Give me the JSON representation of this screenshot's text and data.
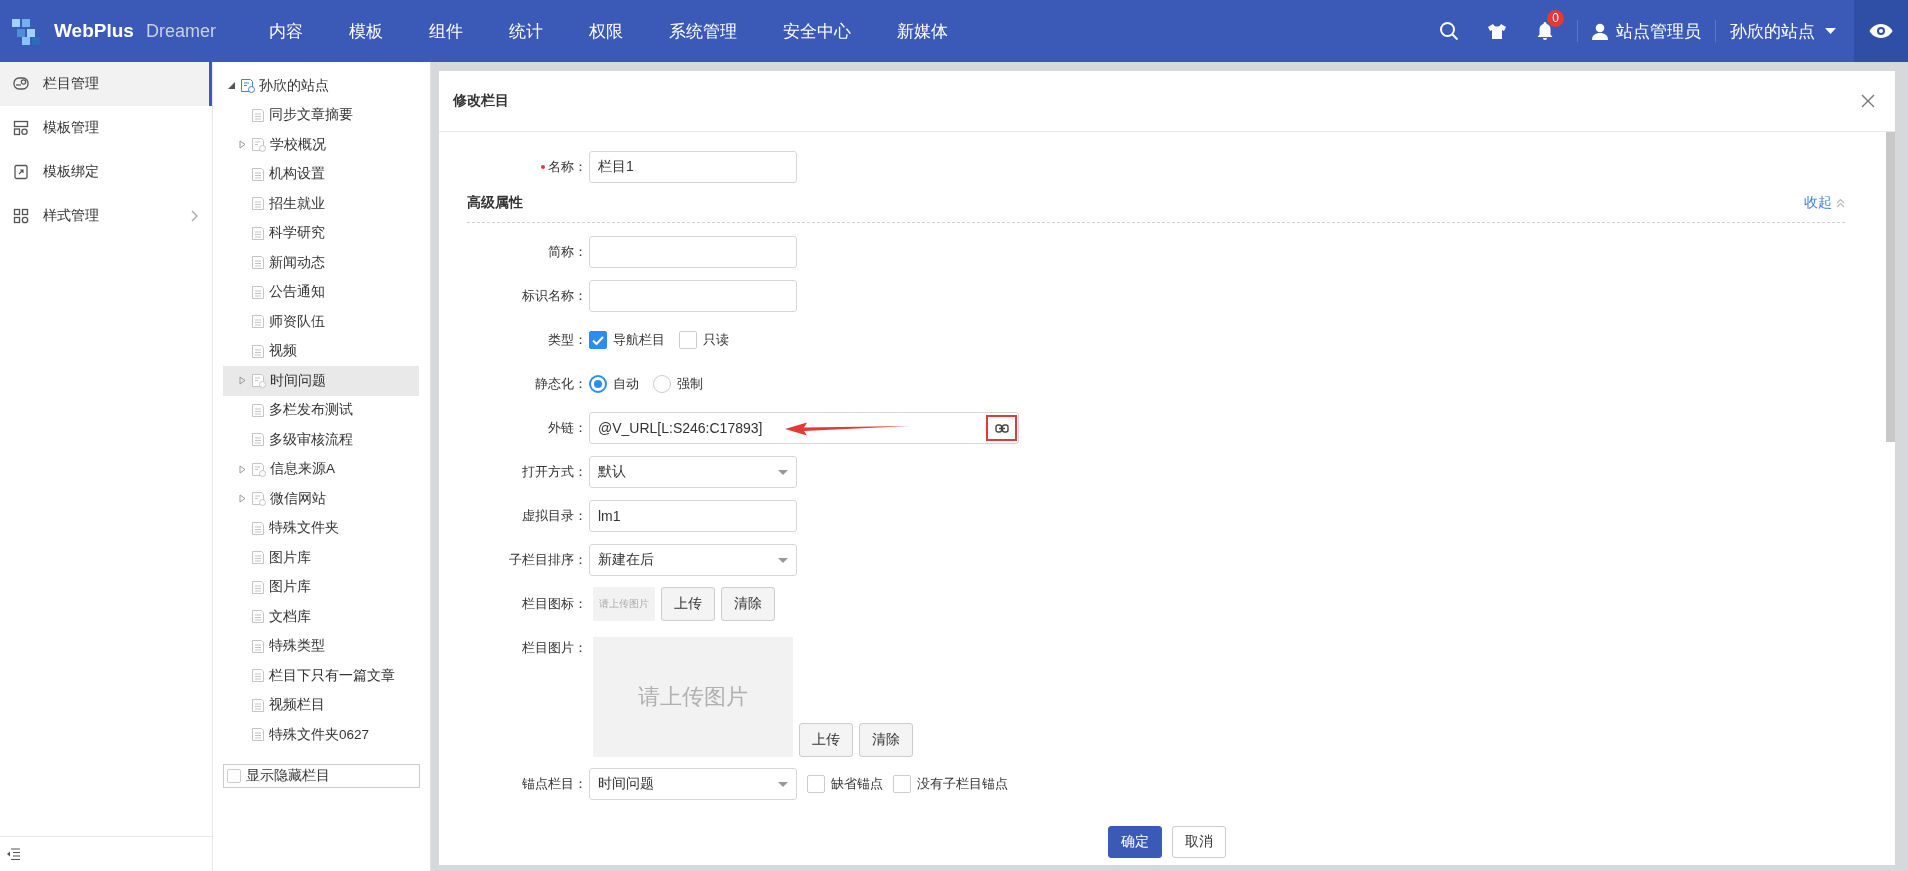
{
  "header": {
    "brand": "WebPlus",
    "product": "Dreamer",
    "nav": [
      {
        "label": "内容"
      },
      {
        "label": "模板"
      },
      {
        "label": "组件"
      },
      {
        "label": "统计"
      },
      {
        "label": "权限"
      },
      {
        "label": "系统管理"
      },
      {
        "label": "安全中心"
      },
      {
        "label": "新媒体"
      }
    ],
    "notification_count": "0",
    "user": "站点管理员",
    "site": "孙欣的站点"
  },
  "sidebar": {
    "items": [
      {
        "label": "栏目管理",
        "selected": true,
        "has_submenu": false
      },
      {
        "label": "模板管理",
        "selected": false,
        "has_submenu": false
      },
      {
        "label": "模板绑定",
        "selected": false,
        "has_submenu": false
      },
      {
        "label": "样式管理",
        "selected": false,
        "has_submenu": true
      }
    ]
  },
  "tree": {
    "root": {
      "label": "孙欣的站点",
      "expanded": true,
      "children": [
        {
          "label": "同步文章摘要",
          "kind": "page",
          "selected": false
        },
        {
          "label": "学校概况",
          "kind": "folder",
          "selected": false
        },
        {
          "label": "机构设置",
          "kind": "page",
          "selected": false
        },
        {
          "label": "招生就业",
          "kind": "page",
          "selected": false
        },
        {
          "label": "科学研究",
          "kind": "page",
          "selected": false
        },
        {
          "label": "新闻动态",
          "kind": "page",
          "selected": false
        },
        {
          "label": "公告通知",
          "kind": "page",
          "selected": false
        },
        {
          "label": "师资队伍",
          "kind": "page",
          "selected": false
        },
        {
          "label": "视频",
          "kind": "page",
          "selected": false
        },
        {
          "label": "时间问题",
          "kind": "folder",
          "selected": true
        },
        {
          "label": "多栏发布测试",
          "kind": "page",
          "selected": false
        },
        {
          "label": "多级审核流程",
          "kind": "page",
          "selected": false
        },
        {
          "label": "信息来源A",
          "kind": "folder",
          "selected": false
        },
        {
          "label": "微信网站",
          "kind": "folder",
          "selected": false
        },
        {
          "label": "特殊文件夹",
          "kind": "page",
          "selected": false
        },
        {
          "label": "图片库",
          "kind": "page",
          "selected": false
        },
        {
          "label": "图片库",
          "kind": "page",
          "selected": false
        },
        {
          "label": "文档库",
          "kind": "page",
          "selected": false
        },
        {
          "label": "特殊类型",
          "kind": "page",
          "selected": false
        },
        {
          "label": "栏目下只有一篇文章",
          "kind": "page",
          "selected": false
        },
        {
          "label": "视频栏目",
          "kind": "page",
          "selected": false
        },
        {
          "label": "特殊文件夹0627",
          "kind": "page",
          "selected": false
        }
      ]
    },
    "show_hidden": {
      "label": "显示隐藏栏目",
      "checked": false
    }
  },
  "dialog": {
    "title": "修改栏目",
    "fields": [
      {
        "kind": "text",
        "label": "名称：",
        "required": true,
        "value": "栏目1"
      },
      {
        "kind": "section",
        "title": "高级属性",
        "toggle": "收起"
      },
      {
        "kind": "text",
        "label": "简称：",
        "required": false
      },
      {
        "kind": "text",
        "label": "标识名称：",
        "required": false
      },
      {
        "kind": "checks",
        "label": "类型：",
        "options": [
          {
            "label": "导航栏目",
            "checked": true
          },
          {
            "label": "只读",
            "checked": false
          }
        ]
      },
      {
        "kind": "radios",
        "label": "静态化：",
        "options": [
          {
            "label": "自动",
            "selected": true
          },
          {
            "label": "强制",
            "selected": false
          }
        ]
      },
      {
        "kind": "link",
        "label": "外链：",
        "value": "@V_URL[L:S246:C17893]"
      },
      {
        "kind": "select",
        "label": "打开方式：",
        "value": "默认"
      },
      {
        "kind": "text",
        "label": "虚拟目录：",
        "required": false,
        "value": "lm1"
      },
      {
        "kind": "select",
        "label": "子栏目排序：",
        "value": "新建在后"
      },
      {
        "kind": "icon_upload",
        "label": "栏目图标：",
        "placeholder": "请上传图片",
        "buttons": [
          "上传",
          "清除"
        ]
      },
      {
        "kind": "image_upload",
        "label": "栏目图片：",
        "placeholder": "请上传图片",
        "buttons": [
          "上传",
          "清除"
        ]
      },
      {
        "kind": "anchor",
        "label": "锚点栏目：",
        "value": "时间问题",
        "options": [
          {
            "label": "缺省锚点",
            "checked": false
          },
          {
            "label": "没有子栏目锚点",
            "checked": false
          }
        ]
      }
    ],
    "buttons": [
      {
        "label": "确定",
        "primary": true
      },
      {
        "label": "取消",
        "primary": false
      }
    ]
  }
}
